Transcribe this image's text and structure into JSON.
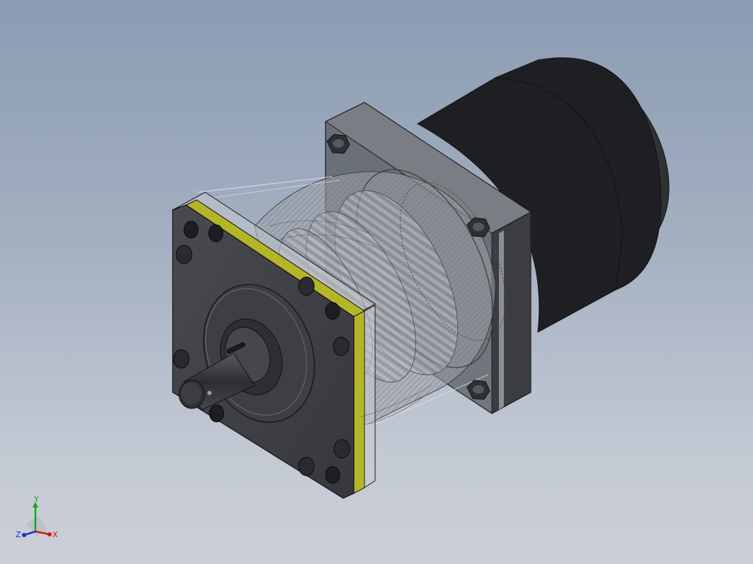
{
  "viewport": {
    "background_top": "#8b9bb2",
    "background_bottom": "#cbd0d8"
  },
  "model": {
    "description_icon": "planetary-gearbox-motor-icon",
    "flange_color": "#3f4147",
    "flange_edge_color": "#b5b52a",
    "motor_color": "#2a2b2e"
  },
  "triad": {
    "x_label": "X",
    "y_label": "Y",
    "z_label": "Z",
    "x_color": "#d01818",
    "y_color": "#18a818",
    "z_color": "#1830d0"
  }
}
